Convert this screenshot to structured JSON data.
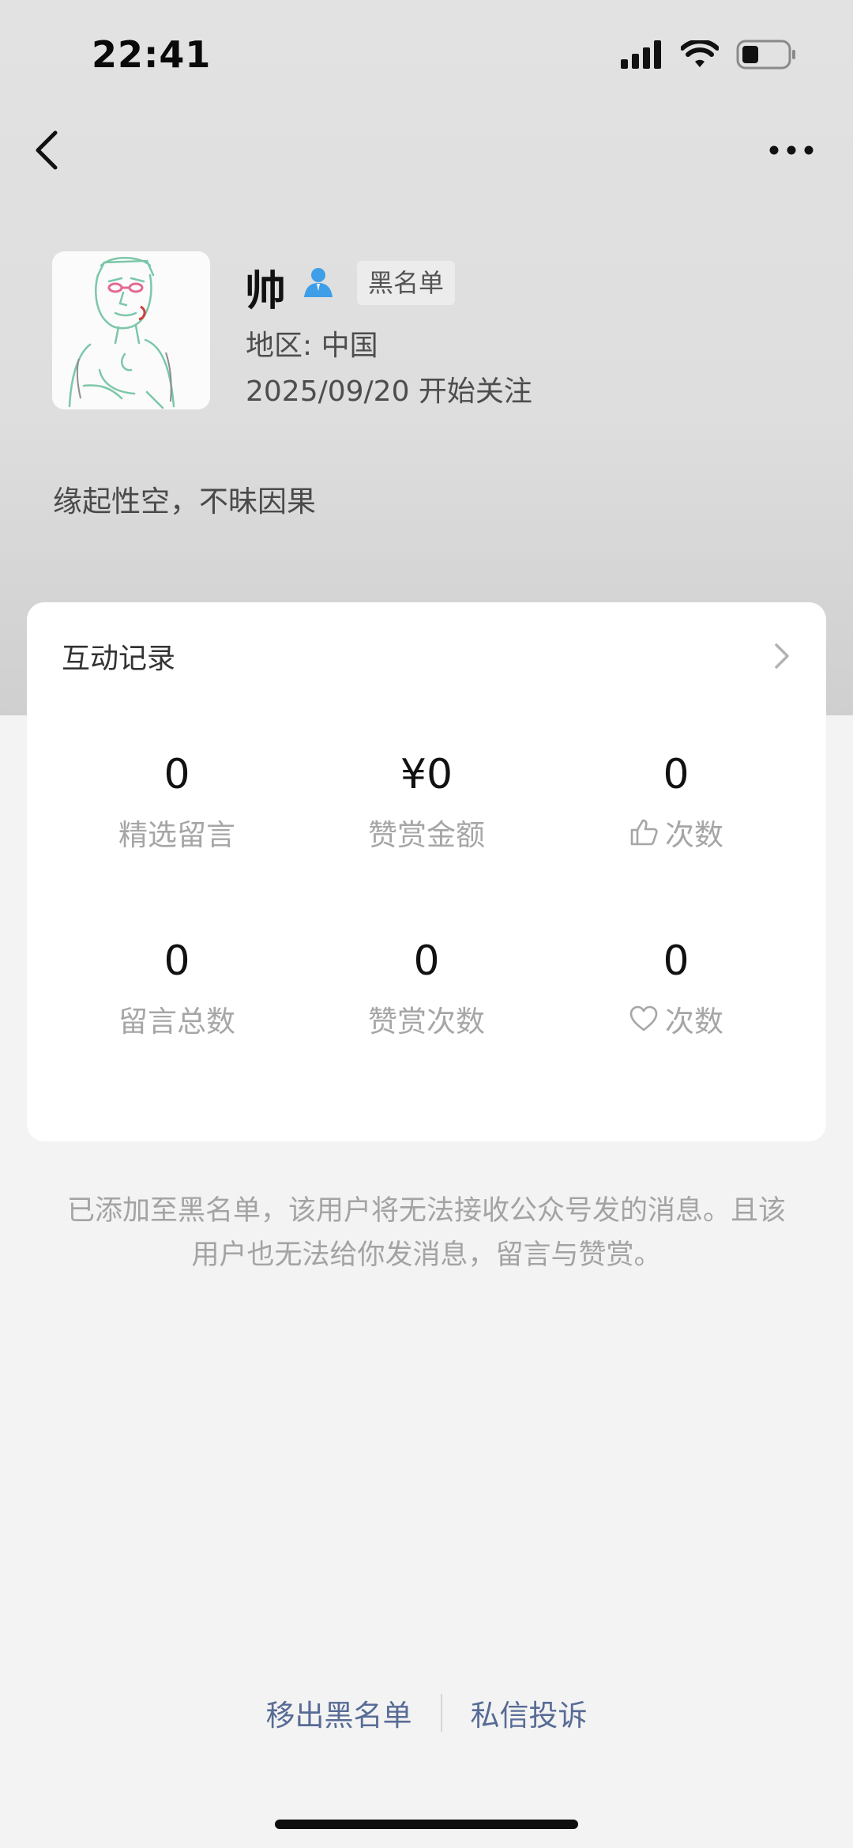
{
  "status_bar": {
    "time": "22:41",
    "icons": [
      "cellular-signal-icon",
      "wifi-icon",
      "battery-icon"
    ]
  },
  "nav": {
    "back_icon": "chevron-left-icon",
    "more_icon": "more-dots-icon"
  },
  "profile": {
    "name": "帅",
    "badge": "黑名单",
    "region": "地区: 中国",
    "follow_date": "2025/09/20 开始关注",
    "signature": "缘起性空，不昧因果",
    "verified_icon": "person-icon",
    "accent_color": "#3f9ee8"
  },
  "interaction_card": {
    "title": "互动记录",
    "stats": [
      {
        "value": "0",
        "label": "精选留言"
      },
      {
        "value": "¥0",
        "label": "赞赏金额"
      },
      {
        "value": "0",
        "label": "次数",
        "icon": "thumbs-up-icon"
      },
      {
        "value": "0",
        "label": "留言总数"
      },
      {
        "value": "0",
        "label": "赞赏次数"
      },
      {
        "value": "0",
        "label": "次数",
        "icon": "heart-icon"
      }
    ]
  },
  "notice": {
    "line1": "已添加至黑名单，该用户将无法接收公众号发的消息。且该",
    "line2": "用户也无法给你发消息，留言与赞赏。"
  },
  "actions": {
    "remove_blacklist": "移出黑名单",
    "report": "私信投诉",
    "link_color": "#576b95"
  }
}
